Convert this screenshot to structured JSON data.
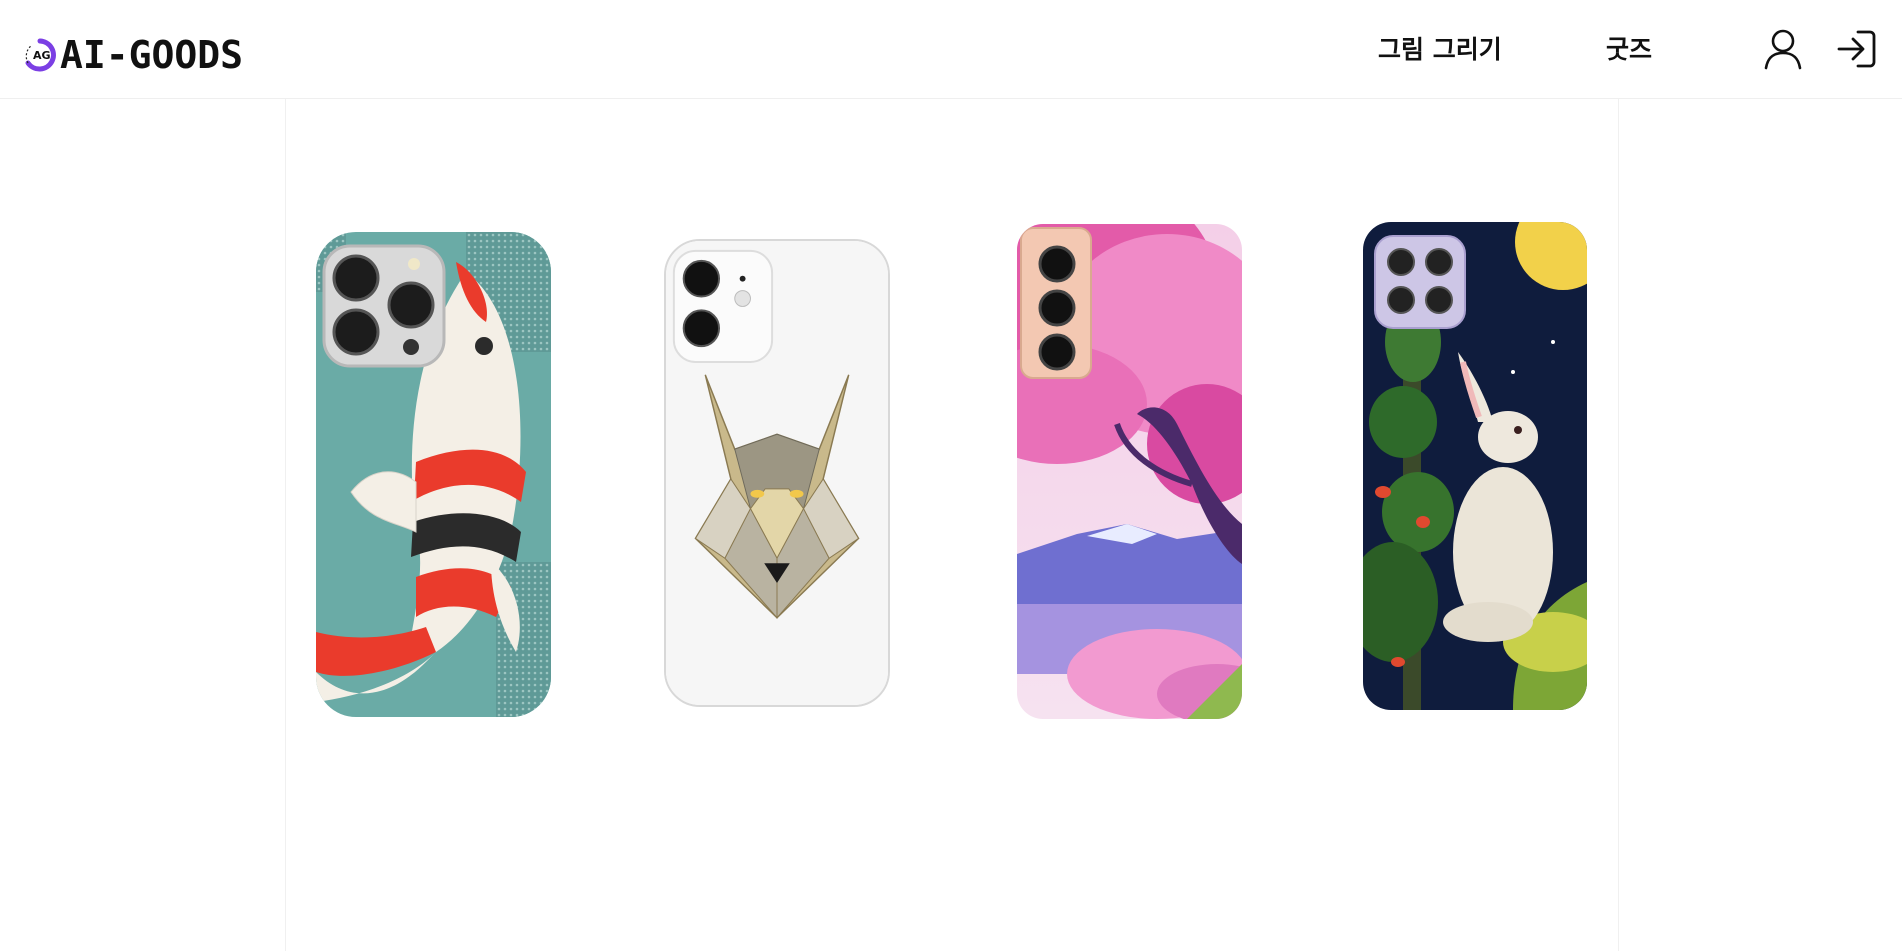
{
  "header": {
    "logo_text": "AI-GOODS",
    "logo_mark_text": "AG",
    "nav": {
      "draw_label": "그림 그리기",
      "goods_label": "굿즈"
    },
    "icons": {
      "user": "user-icon",
      "login": "login-icon"
    }
  },
  "products": [
    {
      "id": "koi-case",
      "design": "koi-fish",
      "colors": {
        "bg": "#6aa9a4",
        "accent": "#ea3b2c"
      }
    },
    {
      "id": "wolf-case",
      "design": "geometric-wolf",
      "colors": {
        "bg": "#f5f5f5",
        "accent": "#b79a5e"
      }
    },
    {
      "id": "cherry-case",
      "design": "cherry-blossom-mountain",
      "colors": {
        "bg": "#e58fc2",
        "accent": "#6f6fd0"
      }
    },
    {
      "id": "rabbit-case",
      "design": "moon-rabbit",
      "colors": {
        "bg": "#0f1c3d",
        "accent": "#f2d14a"
      }
    }
  ]
}
